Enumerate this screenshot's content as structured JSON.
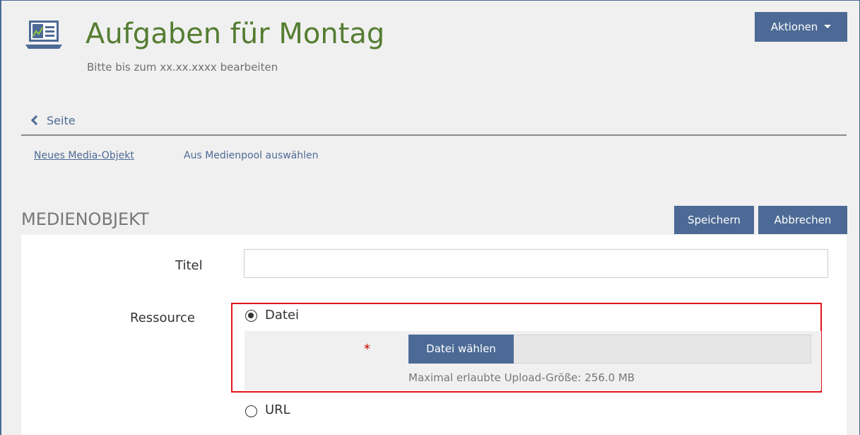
{
  "header": {
    "title": "Aufgaben für Montag",
    "subtitle": "Bitte bis zum xx.xx.xxxx bearbeiten",
    "actions_label": "Aktionen",
    "icon": "presentation-board-icon"
  },
  "nav": {
    "back_label": "Seite"
  },
  "subtabs": [
    {
      "label": "Neues Media-Objekt",
      "active": true
    },
    {
      "label": "Aus Medienpool auswählen",
      "active": false
    }
  ],
  "section": {
    "title": "MEDIENOBJEKT",
    "save_label": "Speichern",
    "cancel_label": "Abbrechen"
  },
  "form": {
    "title_label": "Titel",
    "title_value": "",
    "resource_label": "Ressource",
    "options": [
      {
        "label": "Datei",
        "checked": true
      },
      {
        "label": "URL",
        "checked": false
      }
    ],
    "required_marker": "*",
    "file_button_label": "Datei wählen",
    "upload_hint": "Maximal erlaubte Upload-Größe: 256.0 MB"
  },
  "colors": {
    "accent": "#4c6a95",
    "title_green": "#557d32",
    "highlight_red": "#e0141b",
    "required_red": "#cc0000"
  }
}
